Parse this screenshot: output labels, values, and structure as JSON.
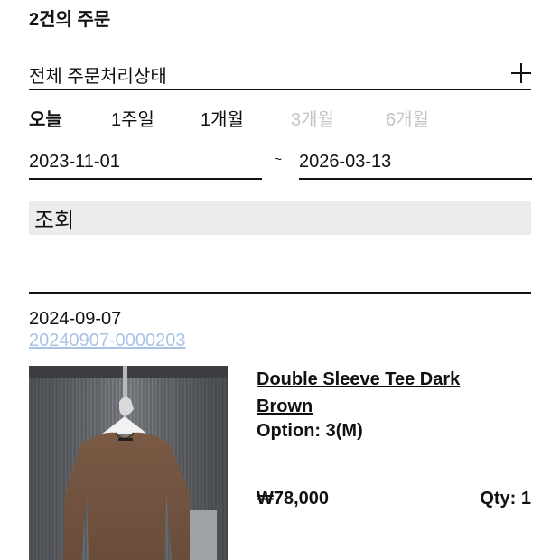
{
  "header": {
    "order_count": "2건의 주문"
  },
  "filter": {
    "status_label": "전체 주문처리상태",
    "icons": {
      "expand": "plus-icon"
    },
    "period_tabs": [
      {
        "label": "오늘",
        "state": "active"
      },
      {
        "label": "1주일",
        "state": "enabled"
      },
      {
        "label": "1개월",
        "state": "enabled"
      },
      {
        "label": "3개월",
        "state": "disabled"
      },
      {
        "label": "6개월",
        "state": "disabled"
      }
    ],
    "start_date": "2023-11-01",
    "separator": "~",
    "end_date": "2026-03-13",
    "search_label": "조회"
  },
  "orders": [
    {
      "date": "2024-09-07",
      "order_number": "20240907-0000203",
      "product": {
        "name": "Double Sleeve Tee Dark Brown",
        "option": "Option: 3(M)",
        "price": "₩78,000",
        "qty": "Qty: 1",
        "image": "brown-long-sleeve-tee-on-hanger"
      }
    }
  ],
  "colors": {
    "text": "#111111",
    "disabled_text": "#c4c4c4",
    "link_order_number": "#a9c3e6",
    "search_button_bg": "#ececec"
  }
}
